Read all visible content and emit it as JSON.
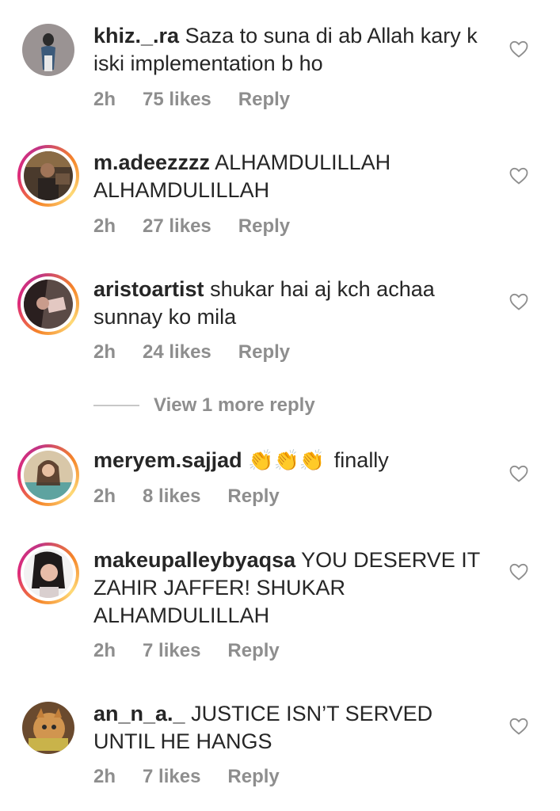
{
  "comments": [
    {
      "username": "khiz._.ra",
      "text": "Saza to suna di ab Allah kary k iski implementation b ho",
      "time": "2h",
      "likes": "75 likes",
      "reply": "Reply"
    },
    {
      "username": "m.adeezzzz",
      "text": "ALHAMDULILLAH ALHAMDULILLAH",
      "time": "2h",
      "likes": "27 likes",
      "reply": "Reply"
    },
    {
      "username": "aristoartist",
      "text": "shukar hai aj kch achaa sunnay ko mila",
      "time": "2h",
      "likes": "24 likes",
      "reply": "Reply"
    },
    {
      "username": "meryem.sajjad",
      "emoji": "👏👏👏",
      "text": "finally",
      "time": "2h",
      "likes": "8 likes",
      "reply": "Reply"
    },
    {
      "username": "makeupalleybyaqsa",
      "text": "YOU DESERVE IT ZAHIR JAFFER! SHUKAR ALHAMDULILLAH",
      "time": "2h",
      "likes": "7 likes",
      "reply": "Reply"
    },
    {
      "username": "an_n_a._",
      "text": "JUSTICE ISN’T SERVED UNTIL HE HANGS",
      "time": "2h",
      "likes": "7 likes",
      "reply": "Reply"
    }
  ],
  "view_more_replies": "View 1 more reply",
  "icons": {
    "heart": "heart-outline-icon"
  },
  "colors": {
    "text": "#262626",
    "meta": "#8e8e8e",
    "story_ring_start": "#f58529",
    "story_ring_end": "#dd2a7b"
  }
}
